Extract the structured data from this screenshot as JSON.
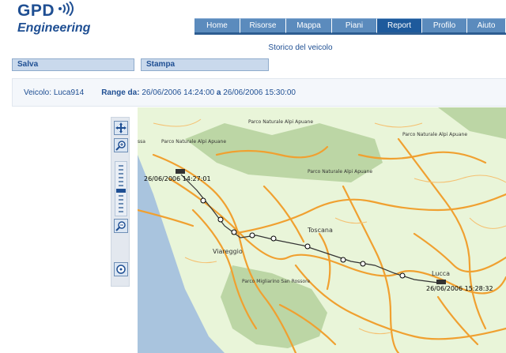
{
  "logo": {
    "line1": "GPD",
    "line2": "Engineering"
  },
  "nav": {
    "tabs": [
      {
        "label": "Home",
        "active": false
      },
      {
        "label": "Risorse",
        "active": false
      },
      {
        "label": "Mappa",
        "active": false
      },
      {
        "label": "Piani",
        "active": false
      },
      {
        "label": "Report",
        "active": true
      },
      {
        "label": "Profilo",
        "active": false
      },
      {
        "label": "Aiuto",
        "active": false
      }
    ]
  },
  "page_title": "Storico del veicolo",
  "actions": {
    "save_label": "Salva",
    "print_label": "Stampa"
  },
  "info": {
    "vehicle_label": "Veicolo:",
    "vehicle_value": "Luca914",
    "range_label": "Range da:",
    "range_from": "26/06/2006 14:24:00",
    "range_sep": "a",
    "range_to": "26/06/2006 15:30:00"
  },
  "map": {
    "labels": {
      "park1": "Parco Naturale Alpi Apuane",
      "park2": "Parco Naturale Alpi Apuane",
      "park3": "Parco Naturale Alpi Apuane",
      "park4": "Parco Naturale Alpi Apuane",
      "city_viareggio": "Viareggio",
      "region_toscana": "Toscana",
      "city_lucca": "Lucca",
      "park_sanrossore": "Parco Migliarino San Rossore",
      "edge_massa": "ssa",
      "start_time": "26/06/2006 14:27:01",
      "end_time": "26/06/2006 15:28:32"
    },
    "colors": {
      "land": "#e9f5d9",
      "sea": "#a9c4de",
      "park": "#bcd6a5",
      "road": "#f0a030",
      "track": "#000000"
    }
  },
  "toolbar": {
    "icons": [
      "pan-icon",
      "zoom-in-icon",
      "zoom-slider",
      "zoom-out-icon",
      "center-icon"
    ]
  }
}
